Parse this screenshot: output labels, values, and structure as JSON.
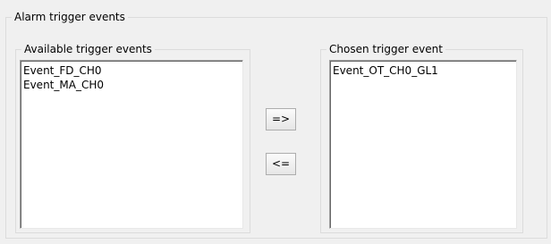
{
  "outer_group": {
    "title": "Alarm trigger events"
  },
  "available_group": {
    "title": "Available trigger events",
    "items": [
      "Event_FD_CH0",
      "Event_MA_CH0"
    ]
  },
  "chosen_group": {
    "title": "Chosen trigger event",
    "items": [
      "Event_OT_CH0_GL1"
    ]
  },
  "buttons": {
    "add_label": "=>",
    "remove_label": "<="
  }
}
